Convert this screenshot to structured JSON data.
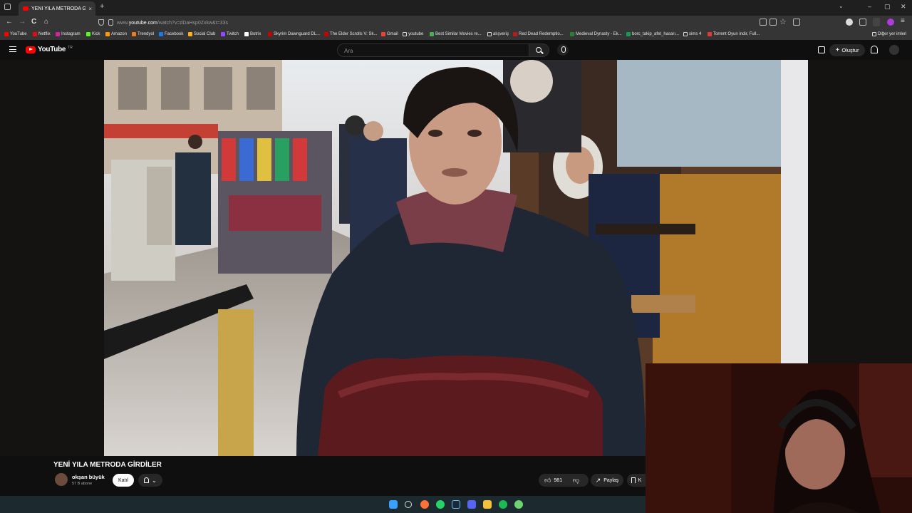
{
  "browser": {
    "tab_title": "YENİ YILA METRODA GİRDİLER",
    "tab_close": "×",
    "new_tab": "+",
    "url_prefix": "www.",
    "url_host": "youtube.com",
    "url_path": "/watch?v=dDaHsp0Zxkw&t=33s",
    "win_min": "–",
    "win_max": "▢",
    "win_close": "✕",
    "back": "←",
    "forward": "→",
    "reload": "C",
    "home": "⌂",
    "bookmarks": [
      {
        "label": "YouTube",
        "color": "#ff0000"
      },
      {
        "label": "Netflix",
        "color": "#e50914"
      },
      {
        "label": "Instagram",
        "color": "#d6249f"
      },
      {
        "label": "Kick",
        "color": "#53fc18"
      },
      {
        "label": "Amazon",
        "color": "#ff9900"
      },
      {
        "label": "Trendyol",
        "color": "#f27a1a"
      },
      {
        "label": "Facebook",
        "color": "#1877f2"
      },
      {
        "label": "Social Club",
        "color": "#fcaf17"
      },
      {
        "label": "Twitch",
        "color": "#9146ff"
      },
      {
        "label": "Botrix",
        "color": "#ffffff"
      },
      {
        "label": "Skyrim Dawnguard DL...",
        "color": "#cc0000"
      },
      {
        "label": "The Elder Scrolls V: Sk...",
        "color": "#cc0000"
      },
      {
        "label": "Gmail",
        "color": "#ea4335"
      },
      {
        "label": "youtube",
        "color": "#dddddd"
      },
      {
        "label": "Best Similar Movies re...",
        "color": "#4caf50"
      },
      {
        "label": "alışveriş",
        "color": "#dddddd"
      },
      {
        "label": "Red Dead Redemptio...",
        "color": "#b71c1c"
      },
      {
        "label": "Medieval Dynasty - Ek...",
        "color": "#2e7d32"
      },
      {
        "label": "borc_takip_afet_hasarı...",
        "color": "#0f9d58"
      },
      {
        "label": "sims 4",
        "color": "#dddddd"
      },
      {
        "label": "Torrent Oyun indir, Full...",
        "color": "#e53935"
      }
    ],
    "other_bookmarks": "Diğer yer imleri"
  },
  "youtube": {
    "logo_text": "YouTube",
    "logo_region": "TR",
    "search_placeholder": "Ara",
    "create_label": "Oluştur"
  },
  "video": {
    "title": "YENİ YILA METRODA GİRDİLER",
    "channel_name": "okşan büyük",
    "subscribers": "57 B abone",
    "join_label": "Katıl",
    "like_count": "981",
    "share_label": "Paylaş",
    "save_label": "K"
  }
}
